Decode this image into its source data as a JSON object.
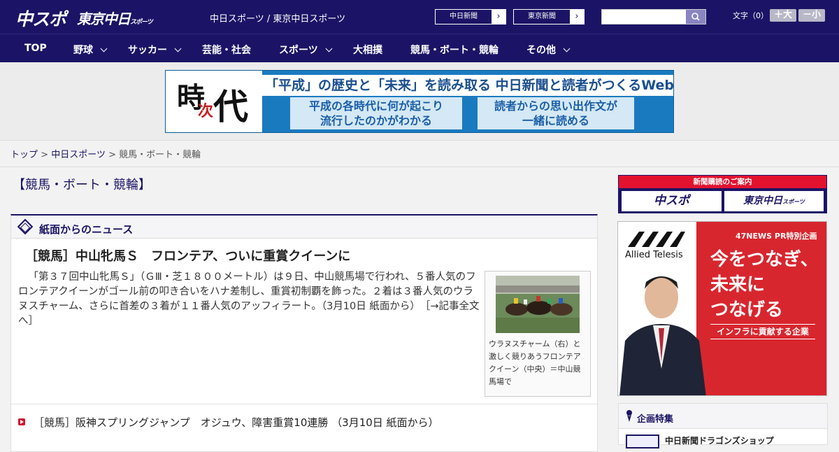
{
  "header": {
    "logo_chuspo": "中スポ",
    "logo_tokyo": "東京中日",
    "logo_tokyo_sub": "スポーツ",
    "site_name": "中日スポーツ / 東京中日スポーツ",
    "paper_buttons": [
      "中日新聞",
      "東京新聞"
    ],
    "search_placeholder": "",
    "fontsize_label": "文字（0）",
    "font_bigger": "＋大",
    "font_smaller": "－小"
  },
  "nav": {
    "items": [
      "TOP",
      "野球",
      "サッカー",
      "芸能・社会",
      "スポーツ",
      "大相撲",
      "競馬・ボート・競輪",
      "その他"
    ]
  },
  "banner": {
    "kanji1": "時",
    "kanji2": "次",
    "kanji3": "代",
    "headline": "「平成」の歴史と「未来」を読み取る 中日新聞と読者がつくるWebサイト",
    "box1_line1": "平成の各時代に何が起こり",
    "box1_line2": "流行したのかがわかる",
    "box2_line1": "読者からの思い出作文が",
    "box2_line2": "一緒に読める"
  },
  "breadcrumb": {
    "top": "トップ",
    "sep": ">",
    "section": "中日スポーツ",
    "current": "競馬・ボート・競輪"
  },
  "main": {
    "category_title": "【競馬・ボート・競輪】",
    "panel_title": "紙面からのニュース",
    "lead_title": "［競馬］中山牝馬Ｓ　フロンテア、ついに重賞クイーンに",
    "lead_body": "「第３７回中山牝馬Ｓ」（ＧⅢ・芝１８００メートル）は９日、中山競馬場で行われ、５番人気のフロンテアクイーンがゴール前の叩き合いをハナ差制し、重賞初制覇を飾った。２着は３番人気のウラヌスチャーム、さらに首差の３着が１１番人気のアッフィラート。（3月10日 紙面から）",
    "lead_more": "［→記事全文へ］",
    "photo_caption": "ウラヌスチャーム（右）と激しく競りあうフロンテアクイーン（中央）＝中山競馬場で",
    "item1": "［競馬］阪神スプリングジャンプ　オジュウ、障害重賞10連勝 （3月10日 紙面から）"
  },
  "sidebar": {
    "subscribe_head": "新聞購読のご案内",
    "subscribe_logo1": "中スポ",
    "subscribe_logo2": "東京中日",
    "subscribe_logo2_sub": "スポーツ",
    "ad_brand": "Allied Telesis",
    "ad_pr": "47NEWS PR特別企画",
    "ad_copy_1": "今をつなぎ、",
    "ad_copy_2": "未来に",
    "ad_copy_3": "つなげる",
    "ad_tag": "インフラに貢献する企業",
    "feature_title": "企画特集",
    "feature_item": "中日新聞ドラゴンズショップ"
  },
  "colors": {
    "brand_navy": "#1b1466",
    "accent_red": "#d01030",
    "banner_blue": "#1a7ac0"
  }
}
